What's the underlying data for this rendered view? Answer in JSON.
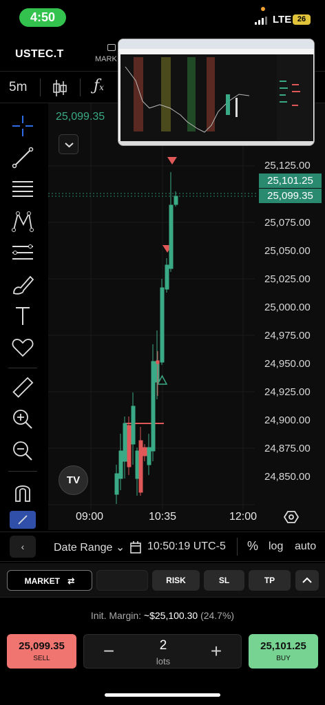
{
  "status": {
    "time": "4:50",
    "network": "LTE",
    "battery": "26"
  },
  "header": {
    "symbol": "USTEC.T",
    "market_tab": "MARK"
  },
  "toolbar": {
    "timeframe": "5m"
  },
  "chart": {
    "last_price_top": "25,099.35",
    "y_labels": [
      "25,125.00",
      "25,075.00",
      "25,050.00",
      "25,025.00",
      "25,000.00",
      "24,975.00",
      "24,950.00",
      "24,925.00",
      "24,900.00",
      "24,875.00",
      "24,850.00"
    ],
    "ask_tag": "25,101.25",
    "bid_tag": "25,099.35",
    "x_labels": [
      "09:00",
      "10:35",
      "12:00"
    ],
    "logo": "TV"
  },
  "range_row": {
    "back": "‹",
    "date_range": "Date Range",
    "clock": "10:50:19 UTC-5",
    "percent": "%",
    "log": "log",
    "auto": "auto"
  },
  "order_bar": {
    "market": "MARKET",
    "risk": "RISK",
    "sl": "SL",
    "tp": "TP"
  },
  "margin": {
    "label": "Init. Margin:",
    "value": "~$25,100.30",
    "pct": "(24.7%)"
  },
  "trade": {
    "sell_price": "25,099.35",
    "sell_label": "SELL",
    "buy_price": "25,101.25",
    "buy_label": "BUY",
    "qty": "2",
    "unit": "lots"
  },
  "colors": {
    "up": "#3aa985",
    "down": "#e05858",
    "ask_tag": "#2a8a70",
    "sell_btn": "#f07570",
    "buy_btn": "#76d392"
  }
}
